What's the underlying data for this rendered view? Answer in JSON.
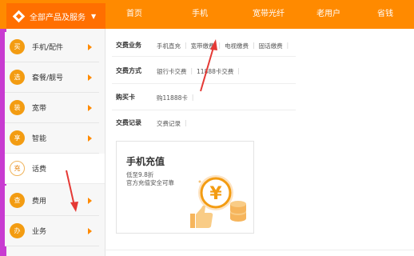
{
  "topnav": {
    "all_products": "全部产品及服务",
    "links": [
      "首页",
      "手机",
      "宽带光纤",
      "老用户",
      "省钱"
    ]
  },
  "sidebar": {
    "items": [
      {
        "label": "手机/配件",
        "icon_char": "买",
        "icon": "buy-icon"
      },
      {
        "label": "套餐/靓号",
        "icon_char": "选",
        "icon": "select-icon"
      },
      {
        "label": "宽带",
        "icon_char": "装",
        "icon": "install-icon"
      },
      {
        "label": "智能",
        "icon_char": "享",
        "icon": "enjoy-icon"
      },
      {
        "label": "话费",
        "icon_char": "充",
        "icon": "recharge-icon"
      },
      {
        "label": "费用",
        "icon_char": "查",
        "icon": "query-icon"
      },
      {
        "label": "业务",
        "icon_char": "办",
        "icon": "handle-icon"
      }
    ]
  },
  "content": {
    "rows": [
      {
        "label": "交费业务",
        "links": [
          "手机直充",
          "宽带缴费",
          "电视缴费",
          "固话缴费"
        ]
      },
      {
        "label": "交费方式",
        "links": [
          "银行卡交费",
          "11888卡交费"
        ]
      },
      {
        "label": "购买卡",
        "links": [
          "购11888卡"
        ]
      },
      {
        "label": "交费记录",
        "links": [
          "交费记录"
        ]
      }
    ],
    "promo": {
      "title": "手机充值",
      "line1": "低至9.8折",
      "line2": "官方充值安全可靠",
      "coin_symbol": "¥"
    }
  },
  "colors": {
    "topbar": "#ff8a00",
    "allprod_bg": "#ff6f00",
    "accent_strip": "#c83bd1",
    "icon_orange": "#f39c12",
    "annotation_red": "#e53935"
  }
}
